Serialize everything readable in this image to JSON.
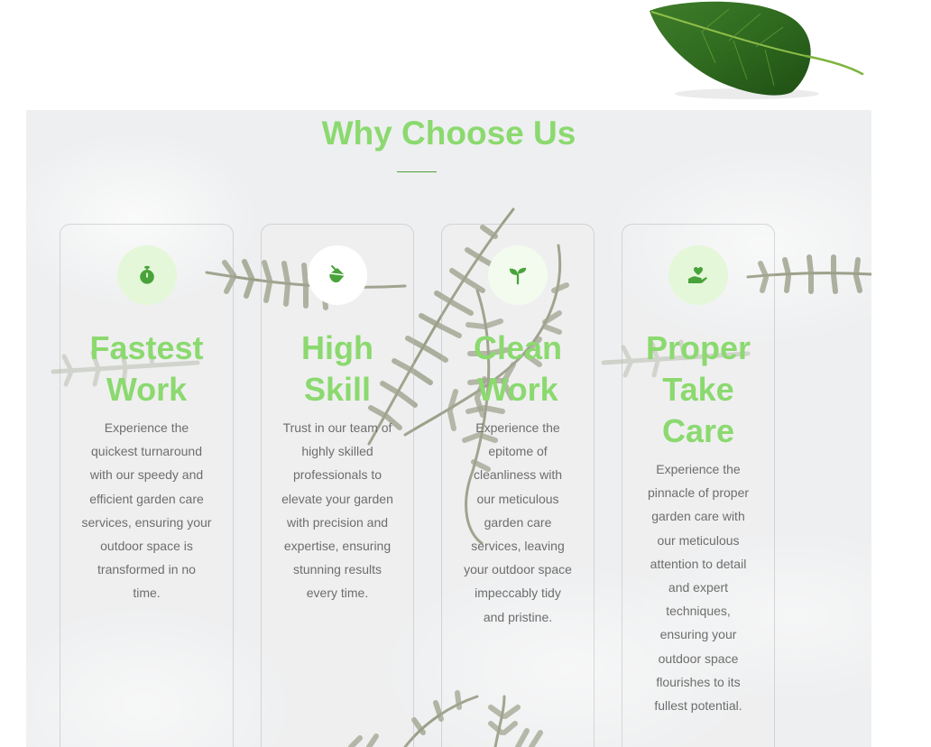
{
  "section": {
    "title": "Why Choose Us"
  },
  "cards": [
    {
      "icon": "stopwatch-icon",
      "title_lines": [
        "Fastest",
        "Work"
      ],
      "text_lines": [
        "Experience the",
        "quickest turnaround",
        "with our speedy and",
        "efficient garden care",
        "services, ensuring your",
        "outdoor space is",
        "transformed in no",
        "time."
      ]
    },
    {
      "icon": "paint-bucket-icon",
      "title_lines": [
        "High",
        "Skill"
      ],
      "text_lines": [
        "Trust in our team of",
        "highly skilled",
        "professionals to",
        "elevate your garden",
        "with precision and",
        "expertise, ensuring",
        "stunning results",
        "every time."
      ]
    },
    {
      "icon": "seedling-icon",
      "title_lines": [
        "Clean",
        "Work"
      ],
      "text_lines": [
        "Experience the",
        "epitome of",
        "cleanliness with",
        "our meticulous",
        "garden care",
        "services, leaving",
        "your outdoor space",
        "impeccably tidy",
        "and pristine."
      ]
    },
    {
      "icon": "hand-holding-heart-icon",
      "title_lines": [
        "Proper",
        "Take",
        "Care"
      ],
      "text_lines": [
        "Experience the",
        "pinnacle of proper",
        "garden care with",
        "our meticulous",
        "attention to detail",
        "and expert",
        "techniques,",
        "ensuring your",
        "outdoor space",
        "flourishes to its",
        "fullest potential."
      ]
    }
  ],
  "colors": {
    "accent": "#8bd96f",
    "icon": "#49a33a",
    "icon_bg": "#e4f7d9",
    "text": "#6d6d6d",
    "section_bg": "#eeeff0"
  }
}
